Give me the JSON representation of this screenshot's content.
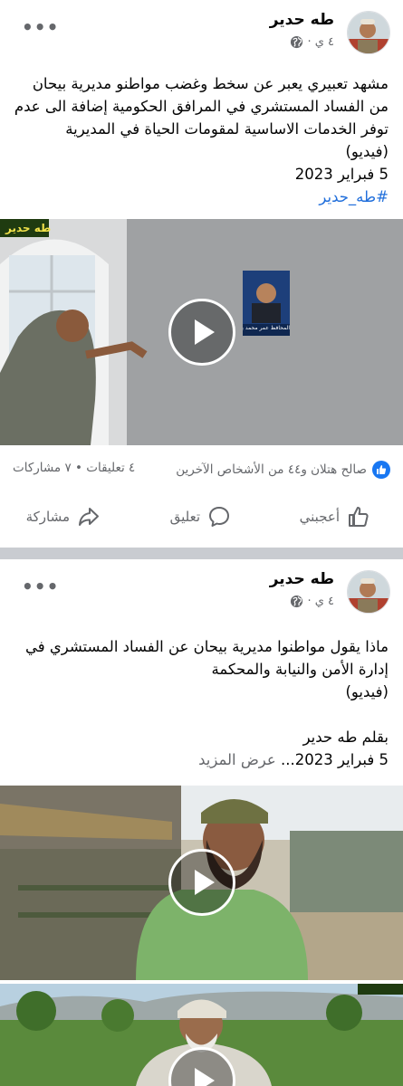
{
  "colors": {
    "link": "#216fdb",
    "secondary": "#65676b",
    "like_blue": "#1877f2",
    "separator": "#c9ccd1"
  },
  "post1": {
    "author": "طه حدير",
    "time": "٤ ي ·",
    "privacy_icon": "globe-icon",
    "more_icon": "more-options-icon",
    "more_label": "•••",
    "text_lines": [
      "مشهد تعبيري يعبر عن سخط وغضب مواطنو مديرية بيحان",
      "من الفساد المستشري في المرافق الحكومية إضافة الى عدم",
      "توفر الخدمات الاساسية لمقومات الحياة في المديرية",
      "(فيديو)",
      "5 فبراير 2023"
    ],
    "hashtag": "#طه_حدير",
    "watermark": "طه حدير",
    "poster_caption": "المحافظ عمر محمد بن الوزير",
    "reactions_text": "صالح هتلان و٤٤ من الأشخاص الآخرين",
    "counts_text": "٤ تعليقات • ٧ مشاركات",
    "actions": {
      "like": "أعجبني",
      "comment": "تعليق",
      "share": "مشاركة"
    }
  },
  "post2": {
    "author": "طه حدير",
    "time": "٤ ي ·",
    "privacy_icon": "globe-icon",
    "more_icon": "more-options-icon",
    "more_label": "•••",
    "text_lines": [
      "ماذا يقول مواطنوا مديرية بيحان عن الفساد المستشري في",
      "إدارة الأمن والنيابة والمحكمة",
      "(فيديو)"
    ],
    "byline": "بقلم طه حدير",
    "date_line": "5 فبراير 2023...",
    "see_more": "عرض المزيد"
  }
}
